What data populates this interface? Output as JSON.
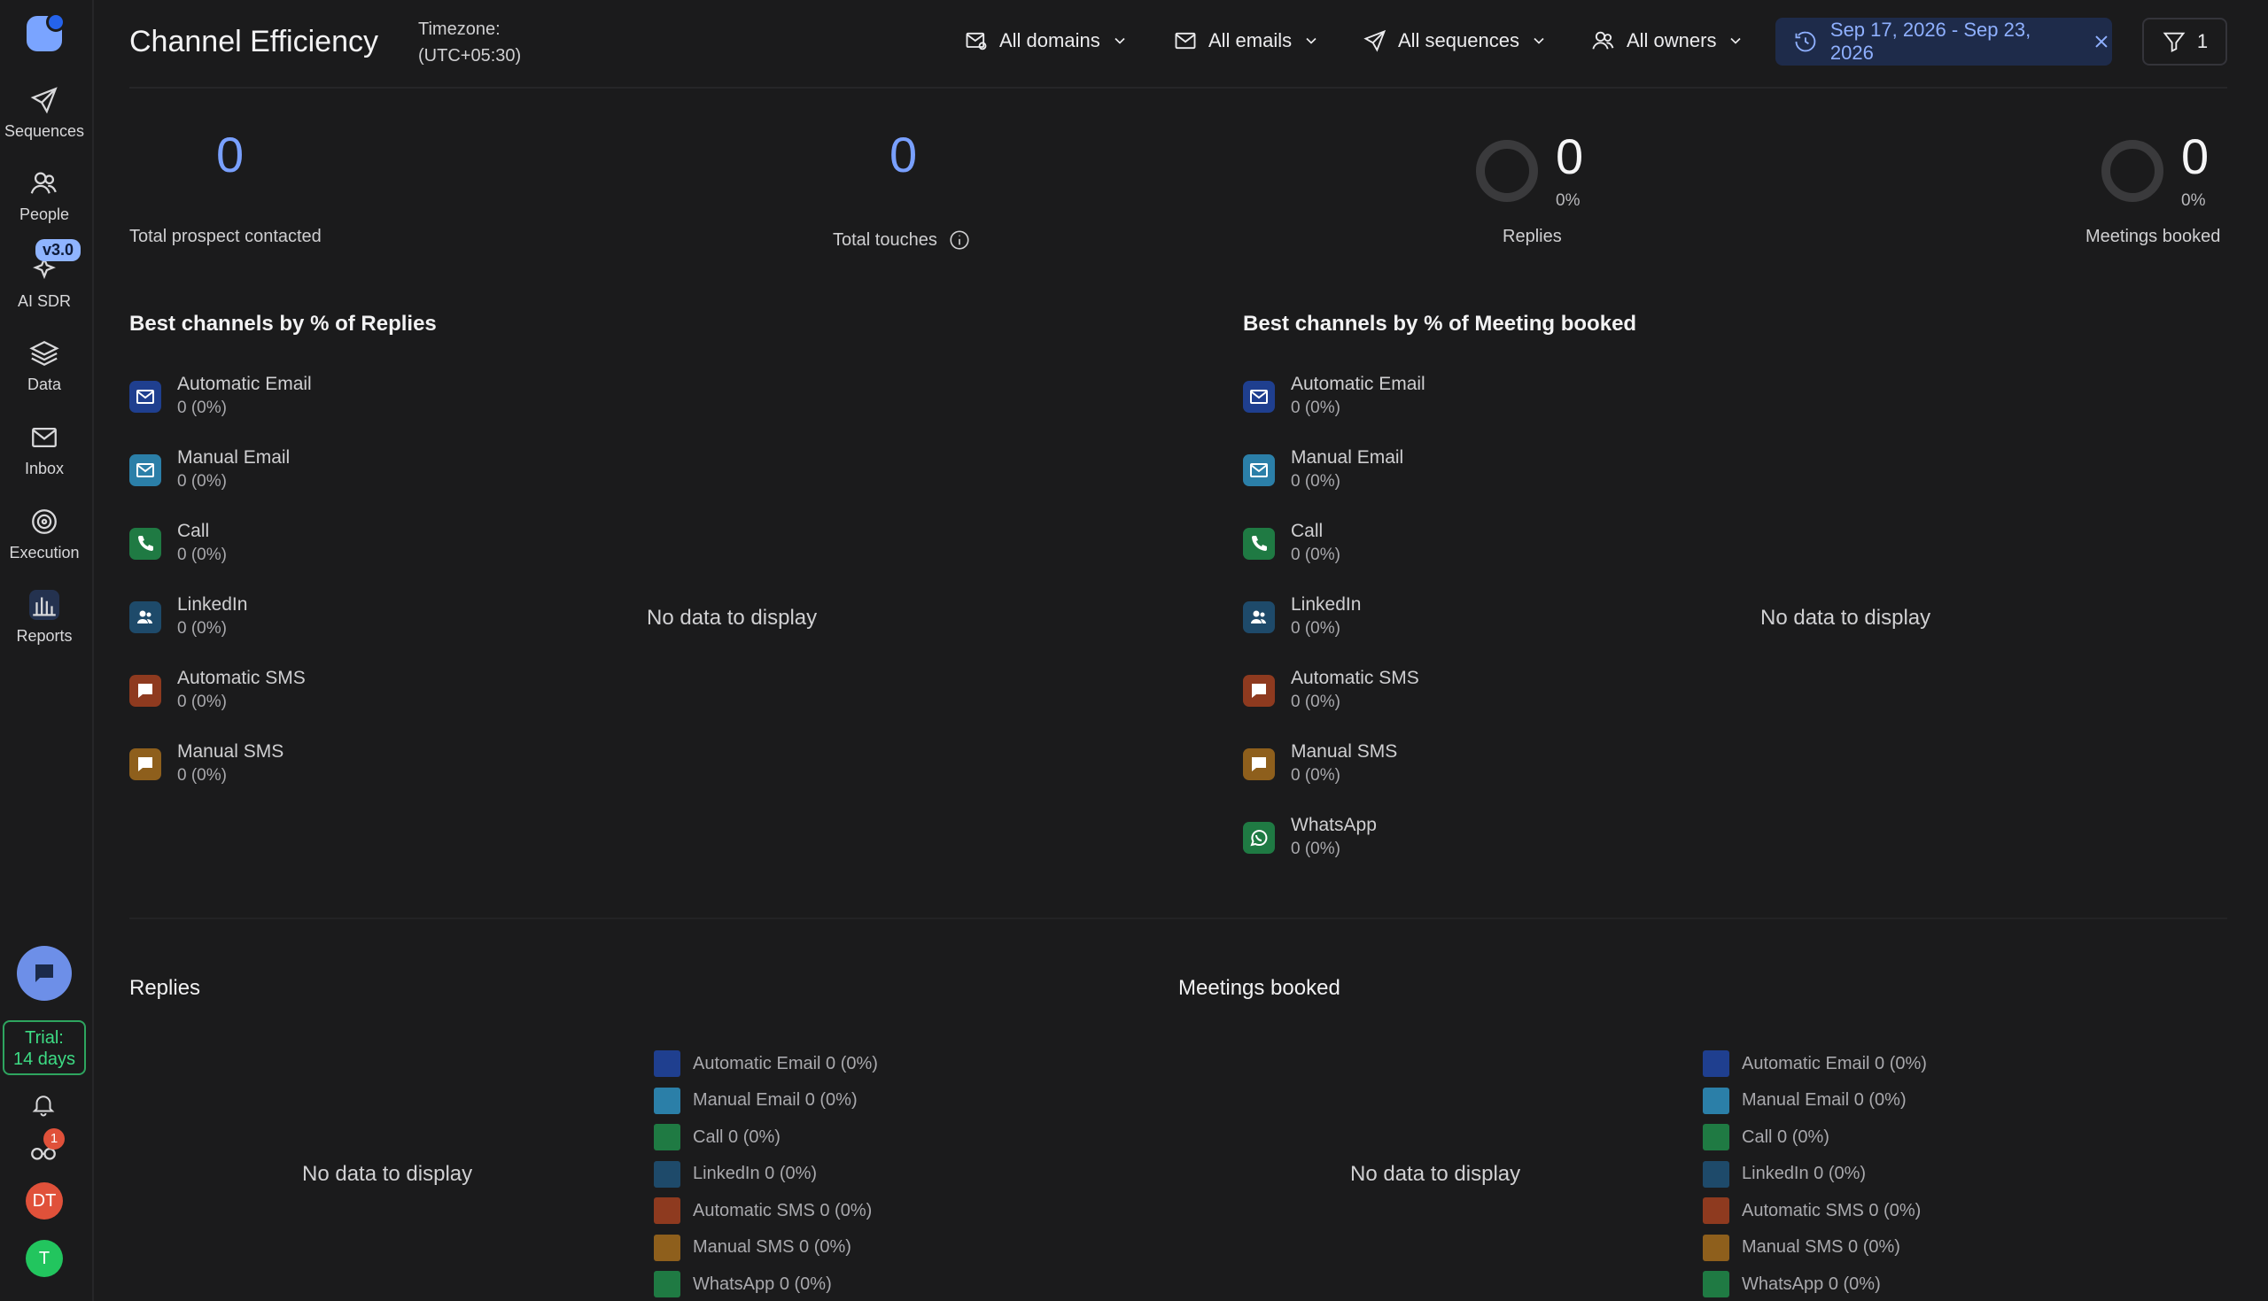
{
  "sidebar": {
    "items": [
      {
        "label": "Sequences",
        "icon": "send-icon"
      },
      {
        "label": "People",
        "icon": "people-icon"
      },
      {
        "label": "AI SDR",
        "icon": "sparkle-icon"
      },
      {
        "label": "Data",
        "icon": "layers-icon"
      },
      {
        "label": "Inbox",
        "icon": "mail-icon"
      },
      {
        "label": "Execution",
        "icon": "target-icon"
      },
      {
        "label": "Reports",
        "icon": "bar-chart-icon"
      }
    ],
    "ai_badge": "v3.0",
    "trial_line1": "Trial:",
    "trial_line2": "14 days",
    "notif_count": "1",
    "avatar1": "DT",
    "avatar2": "T",
    "colors": {
      "avatar1": "#e0513a",
      "avatar2": "#22c55e"
    }
  },
  "header": {
    "title": "Channel Efficiency",
    "tz_label": "Timezone:",
    "tz_value": "(UTC+05:30)",
    "filters": {
      "domains": "All domains",
      "emails": "All emails",
      "sequences": "All sequences",
      "owners": "All owners"
    },
    "date_range": "Sep 17, 2026 - Sep 23, 2026",
    "filter_count": "1"
  },
  "stats": {
    "prospects": {
      "value": "0",
      "label": "Total prospect contacted"
    },
    "touches": {
      "value": "0",
      "label": "Total touches"
    },
    "replies": {
      "value": "0",
      "pct": "0%",
      "label": "Replies"
    },
    "meetings": {
      "value": "0",
      "pct": "0%",
      "label": "Meetings booked"
    }
  },
  "best_replies": {
    "title": "Best channels by % of Replies",
    "no_data": "No data to display",
    "channels": [
      {
        "name": "Automatic Email",
        "value": "0 (0%)",
        "icon": "mail-icon",
        "color": "#1f3f8f"
      },
      {
        "name": "Manual Email",
        "value": "0 (0%)",
        "icon": "mail-icon",
        "color": "#2b7fa8"
      },
      {
        "name": "Call",
        "value": "0 (0%)",
        "icon": "phone-icon",
        "color": "#1f7a43"
      },
      {
        "name": "LinkedIn",
        "value": "0 (0%)",
        "icon": "people-icon",
        "color": "#1e4a6a"
      },
      {
        "name": "Automatic SMS",
        "value": "0 (0%)",
        "icon": "sms-icon",
        "color": "#8e3a1f"
      },
      {
        "name": "Manual SMS",
        "value": "0 (0%)",
        "icon": "sms-icon",
        "color": "#8e5f1c"
      }
    ]
  },
  "best_meetings": {
    "title": "Best channels by % of Meeting booked",
    "no_data": "No data to display",
    "channels": [
      {
        "name": "Automatic Email",
        "value": "0 (0%)",
        "icon": "mail-icon",
        "color": "#1f3f8f"
      },
      {
        "name": "Manual Email",
        "value": "0 (0%)",
        "icon": "mail-icon",
        "color": "#2b7fa8"
      },
      {
        "name": "Call",
        "value": "0 (0%)",
        "icon": "phone-icon",
        "color": "#1f7a43"
      },
      {
        "name": "LinkedIn",
        "value": "0 (0%)",
        "icon": "people-icon",
        "color": "#1e4a6a"
      },
      {
        "name": "Automatic SMS",
        "value": "0 (0%)",
        "icon": "sms-icon",
        "color": "#8e3a1f"
      },
      {
        "name": "Manual SMS",
        "value": "0 (0%)",
        "icon": "sms-icon",
        "color": "#8e5f1c"
      },
      {
        "name": "WhatsApp",
        "value": "0 (0%)",
        "icon": "whatsapp-icon",
        "color": "#1f7a43"
      }
    ]
  },
  "replies_chart": {
    "title": "Replies",
    "no_data": "No data to display",
    "legend": [
      {
        "label": "Automatic Email 0 (0%)",
        "color": "#1f3f8f"
      },
      {
        "label": "Manual Email 0 (0%)",
        "color": "#2b7fa8"
      },
      {
        "label": "Call 0 (0%)",
        "color": "#1f7a43"
      },
      {
        "label": "LinkedIn 0 (0%)",
        "color": "#1e4a6a"
      },
      {
        "label": "Automatic SMS 0 (0%)",
        "color": "#8e3a1f"
      },
      {
        "label": "Manual SMS 0 (0%)",
        "color": "#8e5f1c"
      },
      {
        "label": "WhatsApp 0 (0%)",
        "color": "#1f7a43"
      }
    ]
  },
  "meetings_chart": {
    "title": "Meetings booked",
    "no_data": "No data to display",
    "legend": [
      {
        "label": "Automatic Email 0 (0%)",
        "color": "#1f3f8f"
      },
      {
        "label": "Manual Email 0 (0%)",
        "color": "#2b7fa8"
      },
      {
        "label": "Call 0 (0%)",
        "color": "#1f7a43"
      },
      {
        "label": "LinkedIn 0 (0%)",
        "color": "#1e4a6a"
      },
      {
        "label": "Automatic SMS 0 (0%)",
        "color": "#8e3a1f"
      },
      {
        "label": "Manual SMS 0 (0%)",
        "color": "#8e5f1c"
      },
      {
        "label": "WhatsApp 0 (0%)",
        "color": "#1f7a43"
      }
    ]
  }
}
